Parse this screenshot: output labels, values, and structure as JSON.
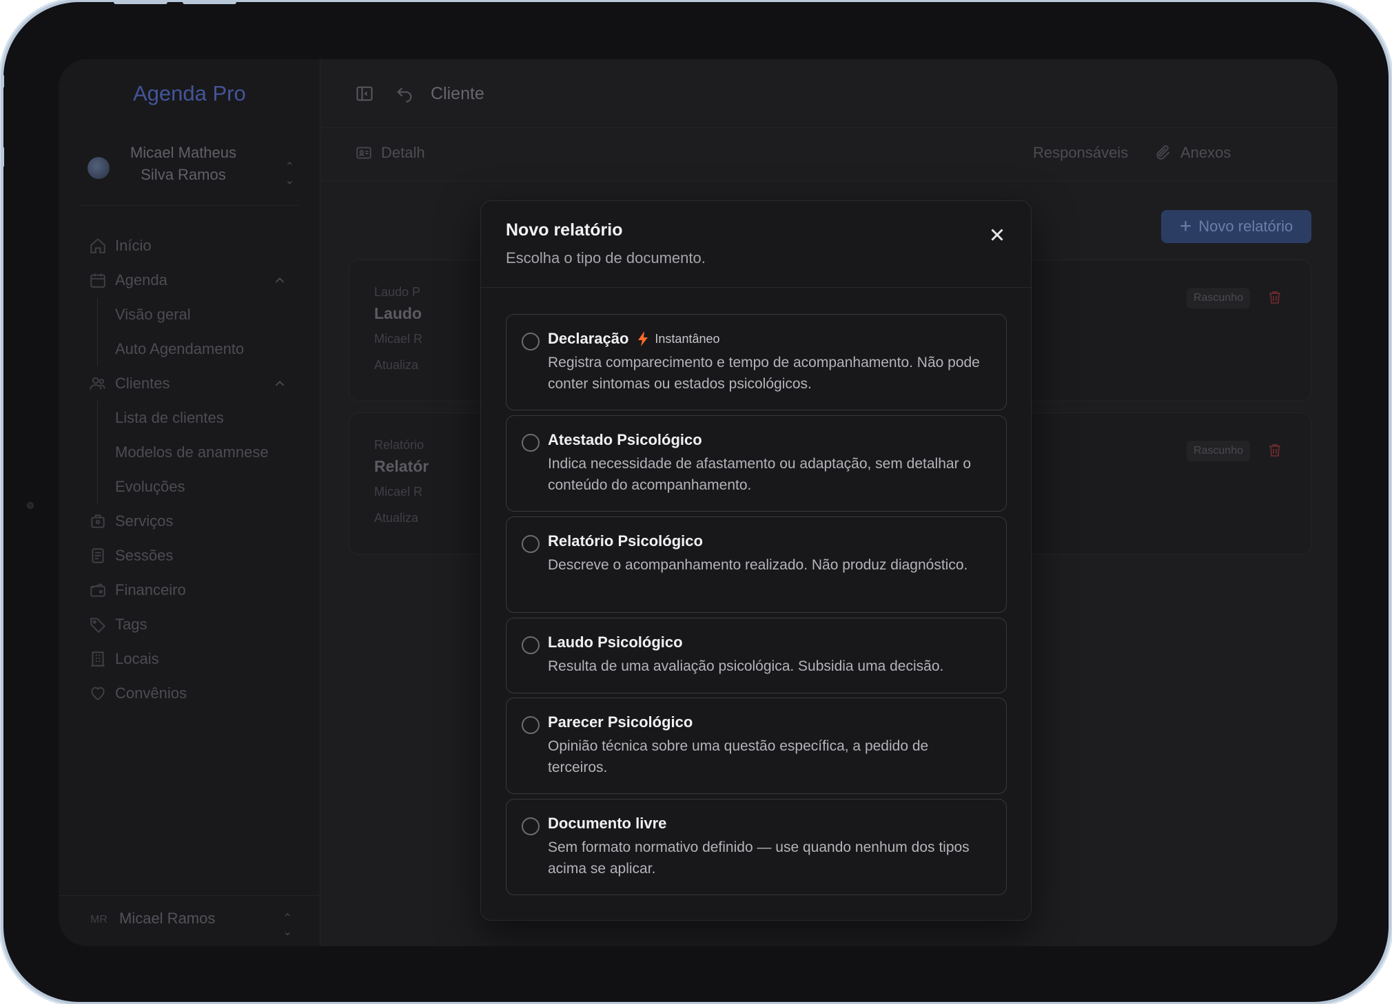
{
  "app": {
    "brand": "Agenda Pro"
  },
  "account": {
    "name": "Micael Matheus Silva Ramos"
  },
  "sidebar": {
    "items": [
      {
        "label": "Início",
        "icon": "home-icon"
      },
      {
        "label": "Agenda",
        "icon": "calendar-icon",
        "expanded": true,
        "children": [
          {
            "label": "Visão geral"
          },
          {
            "label": "Auto Agendamento"
          }
        ]
      },
      {
        "label": "Clientes",
        "icon": "users-icon",
        "expanded": true,
        "children": [
          {
            "label": "Lista de clientes"
          },
          {
            "label": "Modelos de anamnese"
          },
          {
            "label": "Evoluções"
          }
        ]
      },
      {
        "label": "Serviços",
        "icon": "briefcase-icon"
      },
      {
        "label": "Sessões",
        "icon": "document-icon"
      },
      {
        "label": "Financeiro",
        "icon": "wallet-icon"
      },
      {
        "label": "Tags",
        "icon": "tag-icon"
      },
      {
        "label": "Locais",
        "icon": "building-icon"
      },
      {
        "label": "Convênios",
        "icon": "heart-icon"
      }
    ]
  },
  "footer_user": {
    "initials": "MR",
    "name": "Micael Ramos"
  },
  "header": {
    "title": "Cliente"
  },
  "tabs": [
    {
      "label": "Detalh",
      "icon": "id-card-icon"
    },
    {
      "label": "Responsáveis",
      "icon": ""
    },
    {
      "label": "Anexos",
      "icon": "paperclip-icon"
    }
  ],
  "new_report_button": "Novo relatório",
  "cards": [
    {
      "kind": "Laudo P",
      "title": "Laudo",
      "owner": "Micael R",
      "updated": "Atualiza",
      "badge": "Rascunho"
    },
    {
      "kind": "Relatório",
      "title": "Relatór",
      "owner": "Micael R",
      "updated": "Atualiza",
      "badge": "Rascunho"
    }
  ],
  "modal": {
    "title": "Novo relatório",
    "subtitle": "Escolha o tipo de documento.",
    "options": [
      {
        "title": "Declaração",
        "tag": "Instantâneo",
        "description": "Registra comparecimento e tempo de acompanhamento. Não pode conter sintomas ou estados psicológicos."
      },
      {
        "title": "Atestado Psicológico",
        "description": "Indica necessidade de afastamento ou adaptação, sem detalhar o conteúdo do acompanhamento."
      },
      {
        "title": "Relatório Psicológico",
        "description": "Descreve o acompanhamento realizado. Não produz diagnóstico."
      },
      {
        "title": "Laudo Psicológico",
        "description": "Resulta de uma avaliação psicológica. Subsidia uma decisão."
      },
      {
        "title": "Parecer Psicológico",
        "description": "Opinião técnica sobre uma questão específica, a pedido de terceiros."
      },
      {
        "title": "Documento livre",
        "description": "Sem formato normativo definido — use quando nenhum dos tipos acima se aplicar."
      }
    ]
  },
  "colors": {
    "accent": "#2c3d63",
    "bolt": "#ff6a2a",
    "brand": "#43559a",
    "danger": "#6a2a2e"
  }
}
